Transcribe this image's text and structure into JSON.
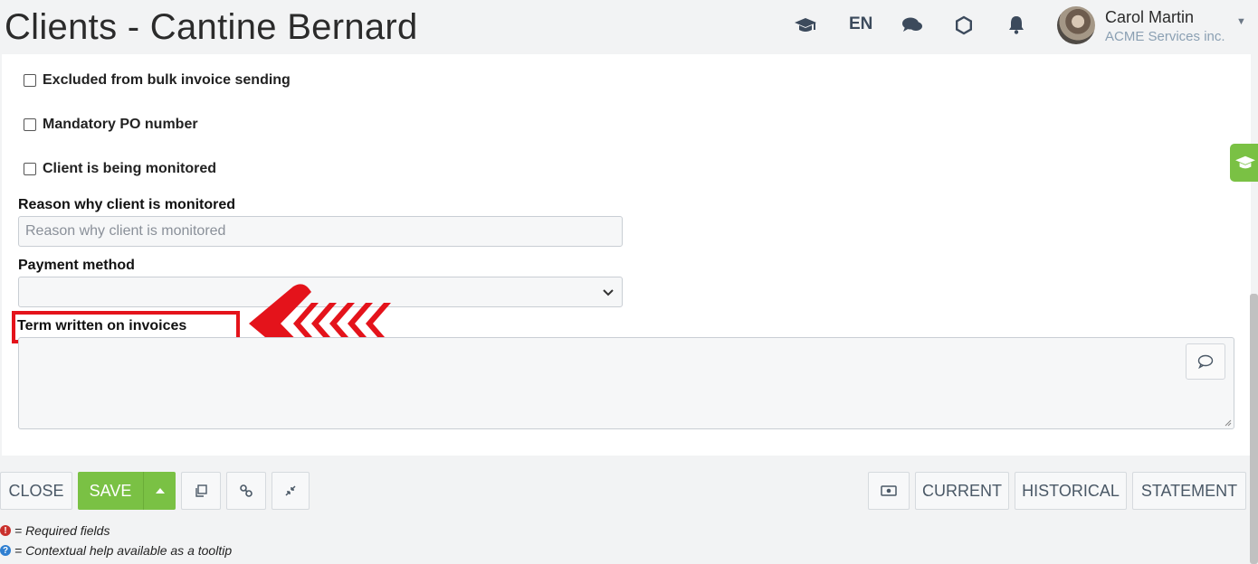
{
  "header": {
    "title": "Clients - Cantine Bernard",
    "language": "EN",
    "user_name": "Carol Martin",
    "user_company": "ACME Services inc."
  },
  "form": {
    "checkboxes": [
      {
        "label": "Excluded from bulk invoice sending",
        "checked": false
      },
      {
        "label": "Mandatory PO number",
        "checked": false
      },
      {
        "label": "Client is being monitored",
        "checked": false
      }
    ],
    "monitor_reason": {
      "label": "Reason why client is monitored",
      "placeholder": "Reason why client is monitored",
      "value": ""
    },
    "payment_method": {
      "label": "Payment method",
      "value": ""
    },
    "invoice_term": {
      "label": "Term written on invoices",
      "value": ""
    }
  },
  "toolbar": {
    "close_label": "CLOSE",
    "save_label": "SAVE",
    "current_label": "CURRENT",
    "historical_label": "HISTORICAL",
    "statement_label": "STATEMENT"
  },
  "legend": {
    "required": "= Required fields",
    "help": "= Contextual help available as a tooltip"
  },
  "colors": {
    "accent_green": "#7ac144",
    "highlight_red": "#e4131b",
    "required_red": "#c9302c",
    "help_blue": "#2f7fd1"
  },
  "icons": [
    "graduation-cap-icon",
    "chat-bubbles-icon",
    "settings-icon",
    "bell-icon",
    "chevron-down-icon",
    "comment-icon",
    "copy-icon",
    "link-icon",
    "collapse-icon",
    "money-icon"
  ]
}
